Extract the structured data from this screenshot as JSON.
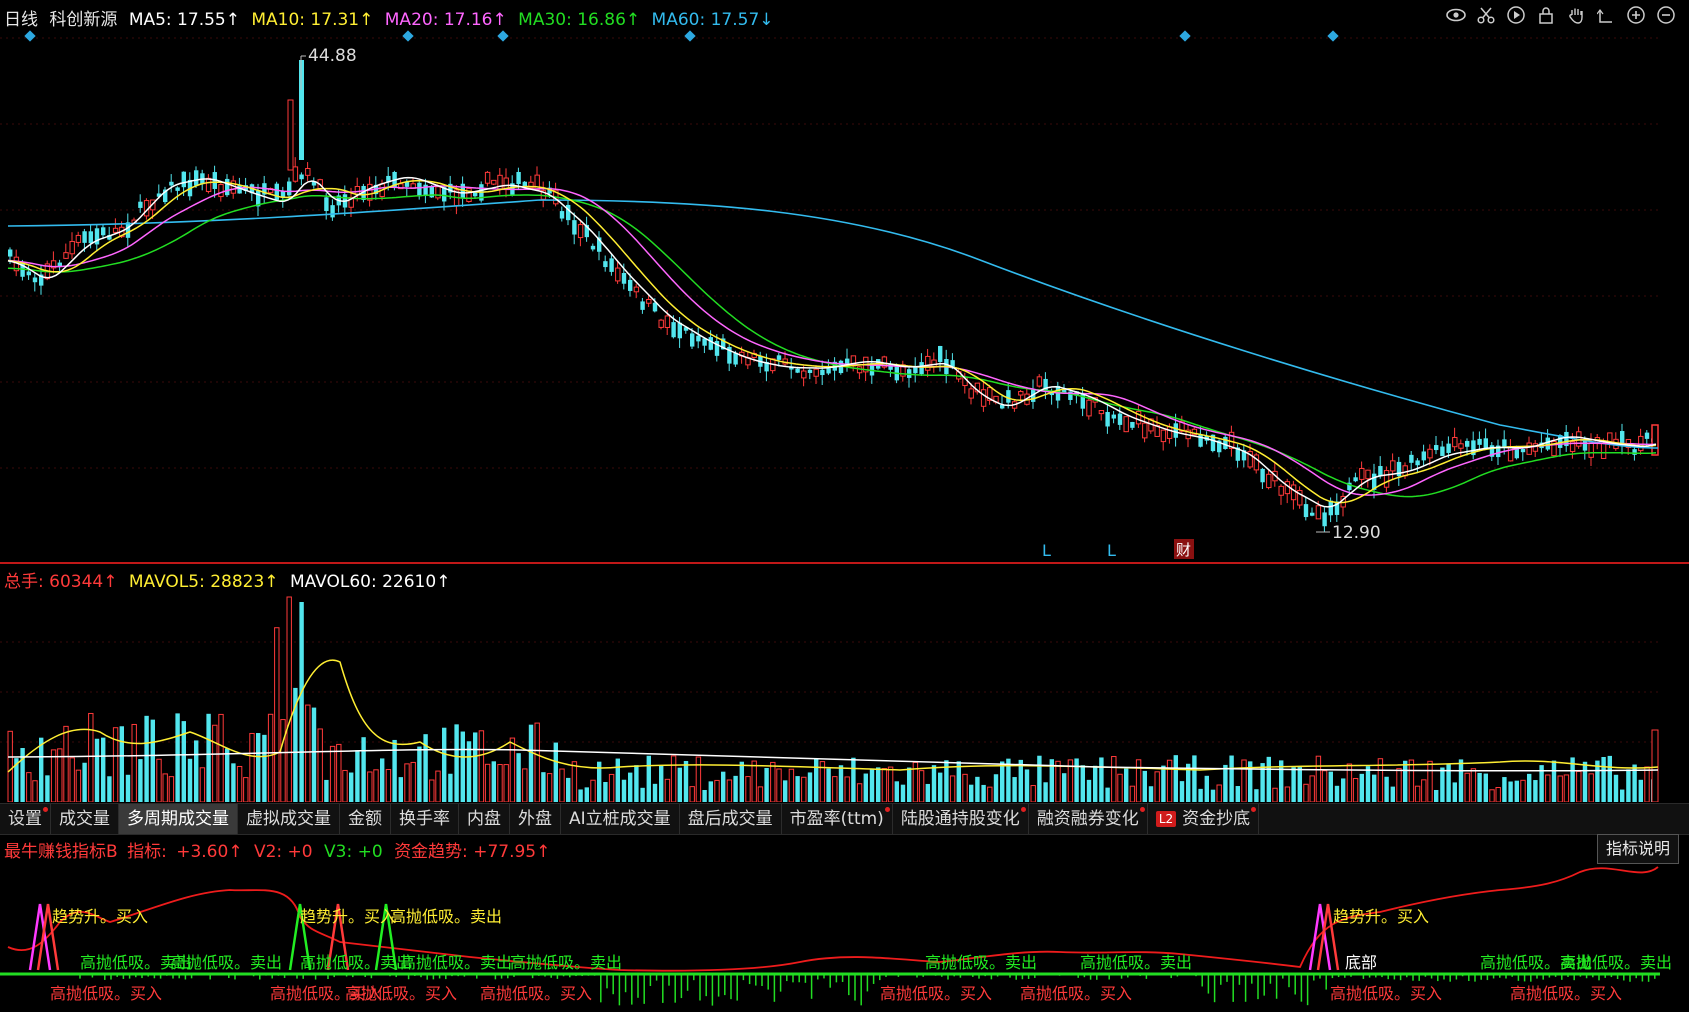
{
  "chart_header": {
    "period": "日线",
    "stock": "科创新源",
    "ma5": "MA5: 17.55↑",
    "ma10": "MA10: 17.31↑",
    "ma20": "MA20: 17.16↑",
    "ma30": "MA30: 16.86↑",
    "ma60": "MA60: 17.57↓"
  },
  "colors": {
    "up": "#ff3a3a",
    "down": "#52e6ee",
    "ma5": "#ffffff",
    "ma10": "#ffee33",
    "ma20": "#ff66ff",
    "ma30": "#22dd22",
    "ma60": "#33bbee",
    "label_red": "#ff3333"
  },
  "price_annotations": {
    "high": "44.88",
    "low": "12.90"
  },
  "event_markers": [
    "L",
    "L",
    "财"
  ],
  "volume_header": {
    "total": "总手: 60344↑",
    "mavol5": "MAVOL5: 28823↑",
    "mavol60": "MAVOL60: 22610↑"
  },
  "tabs": [
    {
      "label": "设置",
      "dot": true,
      "active": false
    },
    {
      "label": "成交量",
      "dot": false,
      "active": false
    },
    {
      "label": "多周期成交量",
      "dot": false,
      "active": true
    },
    {
      "label": "虚拟成交量",
      "dot": false,
      "active": false
    },
    {
      "label": "金额",
      "dot": false,
      "active": false
    },
    {
      "label": "换手率",
      "dot": false,
      "active": false
    },
    {
      "label": "内盘",
      "dot": false,
      "active": false
    },
    {
      "label": "外盘",
      "dot": false,
      "active": false
    },
    {
      "label": "AI立桩成交量",
      "dot": false,
      "active": false
    },
    {
      "label": "盘后成交量",
      "dot": false,
      "active": false
    },
    {
      "label": "市盈率(ttm)",
      "dot": true,
      "active": false
    },
    {
      "label": "陆股通持股变化",
      "dot": true,
      "active": false
    },
    {
      "label": "融资融券变化",
      "dot": true,
      "active": false
    },
    {
      "label": "资金抄底",
      "dot": true,
      "active": false,
      "badge": "L2"
    }
  ],
  "indicator_header": {
    "name": "最牛赚钱指标B",
    "label": "指标:",
    "value": "+3.60↑",
    "v2": "V2: +0",
    "v3": "V3: +0",
    "fund_trend": "资金趋势: +77.95↑"
  },
  "explain_button": "指标说明",
  "signals": {
    "trend_buy": "趋势升。买入",
    "high_low_sell": "高抛低吸。卖出",
    "high_low_buy": "高抛低吸。买入",
    "bottom": "底部"
  },
  "toolbar_icons": [
    "eye-icon",
    "scissors-icon",
    "play-icon",
    "lock-icon",
    "hand-icon",
    "undo-icon",
    "zoom-in-icon",
    "zoom-out-icon"
  ]
}
